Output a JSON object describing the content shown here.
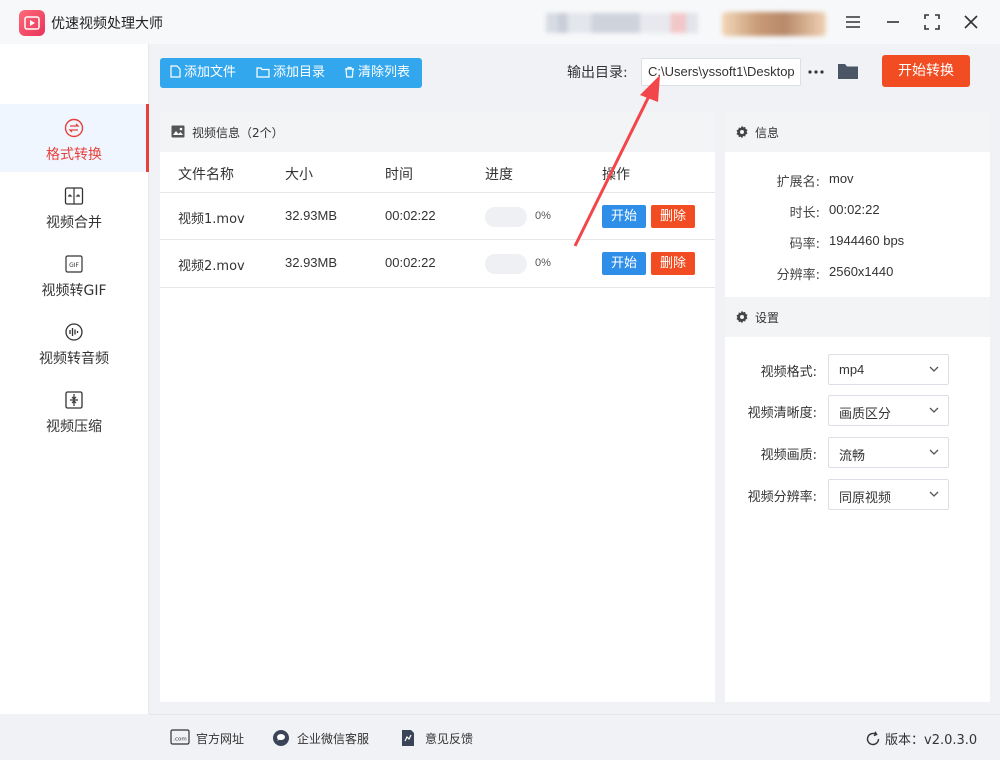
{
  "app": {
    "title": "优速视频处理大师"
  },
  "sidebar": {
    "items": [
      {
        "label": "格式转换",
        "icon": "format-convert-icon",
        "active": true
      },
      {
        "label": "视频合并",
        "icon": "merge-icon",
        "active": false
      },
      {
        "label": "视频转GIF",
        "icon": "gif-icon",
        "active": false
      },
      {
        "label": "视频转音频",
        "icon": "audio-icon",
        "active": false
      },
      {
        "label": "视频压缩",
        "icon": "compress-icon",
        "active": false
      }
    ]
  },
  "toolbar": {
    "add_file": "添加文件",
    "add_dir": "添加目录",
    "clear_list": "清除列表",
    "output_label": "输出目录:",
    "output_path": "C:\\Users\\yssoft1\\Desktop",
    "more": "···",
    "start_all": "开始转换"
  },
  "video_panel": {
    "title": "视频信息（2个）",
    "columns": [
      "文件名称",
      "大小",
      "时间",
      "进度",
      "操作"
    ],
    "rows": [
      {
        "name": "视频1.mov",
        "size": "32.93MB",
        "time": "00:02:22",
        "progress": 0,
        "progress_text": "0%",
        "start": "开始",
        "delete": "删除"
      },
      {
        "name": "视频2.mov",
        "size": "32.93MB",
        "time": "00:02:22",
        "progress": 0,
        "progress_text": "0%",
        "start": "开始",
        "delete": "删除"
      }
    ]
  },
  "info_panel": {
    "title": "信息",
    "fields": [
      {
        "key": "扩展名:",
        "value": "mov"
      },
      {
        "key": "时长:",
        "value": "00:02:22"
      },
      {
        "key": "码率:",
        "value": "1944460 bps"
      },
      {
        "key": "分辨率:",
        "value": "2560x1440"
      }
    ]
  },
  "settings_panel": {
    "title": "设置",
    "fields": [
      {
        "key": "视频格式:",
        "value": "mp4"
      },
      {
        "key": "视频清晰度:",
        "value": "画质区分"
      },
      {
        "key": "视频画质:",
        "value": "流畅"
      },
      {
        "key": "视频分辨率:",
        "value": "同原视频"
      }
    ]
  },
  "footer": {
    "website": "官方网址",
    "wechat": "企业微信客服",
    "feedback": "意见反馈",
    "version": "版本：v2.0.3.0"
  },
  "colors": {
    "accent_red": "#f24d22",
    "accent_blue": "#33a7ee",
    "button_blue": "#2f8fe8",
    "active_nav": "#e8413a"
  }
}
